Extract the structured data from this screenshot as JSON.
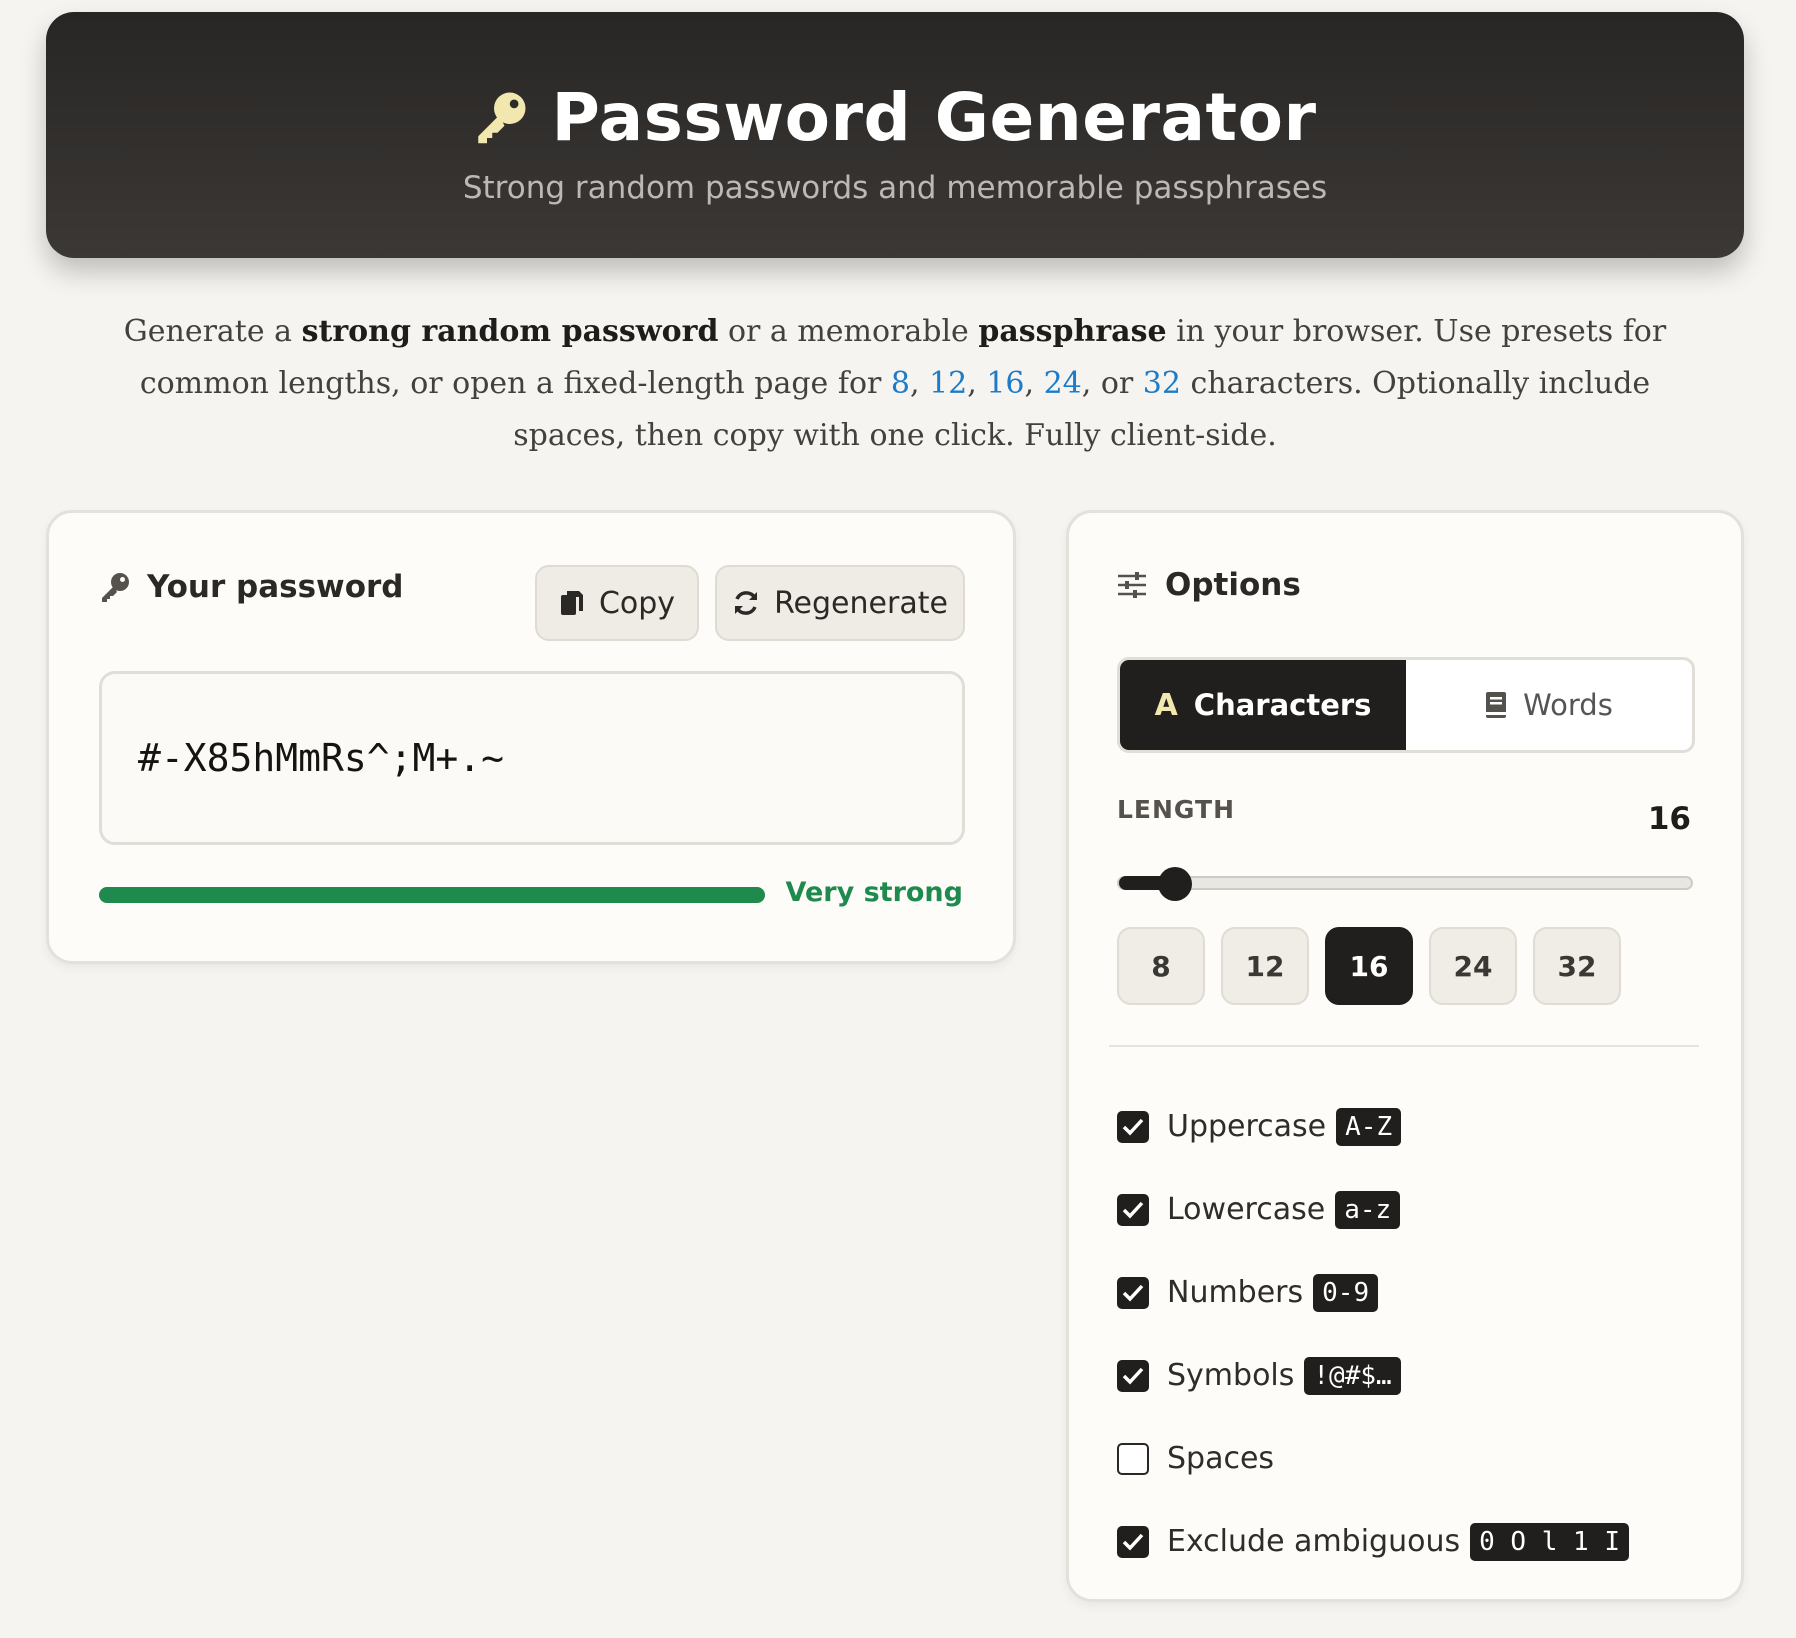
{
  "header": {
    "title": "Password Generator",
    "subtitle": "Strong random passwords and memorable passphrases"
  },
  "intro": {
    "p1": "Generate a ",
    "b1": "strong random password",
    "p2": " or a memorable ",
    "b2": "passphrase",
    "p3": " in your browser. Use presets for common lengths, or open a fixed-length page for ",
    "links": [
      "8",
      "12",
      "16",
      "24",
      "32"
    ],
    "sep1": ", ",
    "sep2": ", ",
    "sep3": ", ",
    "sep4": ", or ",
    "p4": " characters. Optionally include spaces, then copy with one click. Fully client-side."
  },
  "password_panel": {
    "heading": "Your password",
    "copy_label": "Copy",
    "regenerate_label": "Regenerate",
    "value": "#-X85hMmRs^;M+.~",
    "strength_label": "Very strong",
    "strength_fraction": 1.0,
    "strength_color": "#1f8a4d"
  },
  "options": {
    "heading": "Options",
    "tabs": [
      {
        "label": "Characters",
        "icon": "letter-a-icon",
        "active": true
      },
      {
        "label": "Words",
        "icon": "book-icon",
        "active": false
      }
    ],
    "length_label": "LENGTH",
    "length_value": "16",
    "length_slider": {
      "value": 16,
      "min": 4,
      "max": 128
    },
    "presets": [
      "8",
      "12",
      "16",
      "24",
      "32"
    ],
    "active_preset": "16",
    "checkboxes": [
      {
        "label": "Uppercase",
        "tag": "A-Z",
        "checked": true
      },
      {
        "label": "Lowercase",
        "tag": "a-z",
        "checked": true
      },
      {
        "label": "Numbers",
        "tag": "0-9",
        "checked": true
      },
      {
        "label": "Symbols",
        "tag": "!@#$…",
        "checked": true
      },
      {
        "label": "Spaces",
        "tag": "",
        "checked": false
      },
      {
        "label": "Exclude ambiguous",
        "tag": "0 O l 1 I",
        "checked": true
      }
    ]
  },
  "colors": {
    "accent_dark": "#211f1d",
    "link": "#1d7bc7",
    "strong": "#1f8a4d",
    "key_icon": "#f3e7b0"
  }
}
